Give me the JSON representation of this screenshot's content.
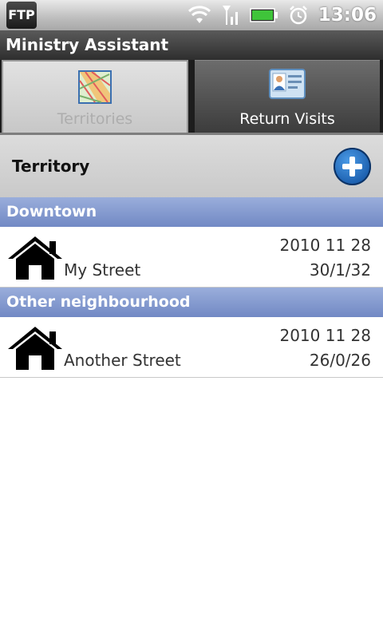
{
  "status_bar": {
    "app_badge": "FTP",
    "time": "13:06",
    "icons": [
      "wifi-icon",
      "signal-icon",
      "battery-icon",
      "alarm-icon"
    ]
  },
  "app": {
    "title": "Ministry Assistant"
  },
  "tabs": [
    {
      "label": "Territories",
      "icon": "map-icon",
      "selected": true
    },
    {
      "label": "Return Visits",
      "icon": "contact-card-icon",
      "selected": false
    }
  ],
  "header": {
    "title": "Territory",
    "add_icon": "plus-circle-icon"
  },
  "groups": [
    {
      "name": "Downtown",
      "items": [
        {
          "street": "My Street",
          "date": "2010 11 28",
          "counts": "30/1/32",
          "icon": "house-icon"
        }
      ]
    },
    {
      "name": "Other neighbourhood",
      "items": [
        {
          "street": "Another Street",
          "date": "2010 11 28",
          "counts": "26/0/26",
          "icon": "house-icon"
        }
      ]
    }
  ],
  "colors": {
    "section_header": "#7f95cc",
    "title_bar": "#3a3a3a",
    "add_button": "#1c5fae"
  }
}
